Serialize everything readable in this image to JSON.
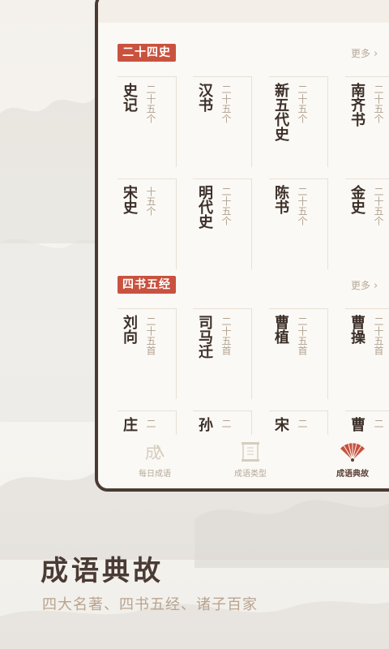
{
  "sections": [
    {
      "tag": "二十四史",
      "more_label": "更多",
      "items": [
        {
          "name": "史记",
          "count": "二十五个"
        },
        {
          "name": "汉书",
          "count": "二十五个"
        },
        {
          "name": "新五代史",
          "count": "二十五个"
        },
        {
          "name": "南齐书",
          "count": "二十五个"
        },
        {
          "name": "宋史",
          "count": "十五个"
        },
        {
          "name": "明代史",
          "count": "二十五个"
        },
        {
          "name": "陈书",
          "count": "二十五个"
        },
        {
          "name": "金史",
          "count": "二十五个"
        }
      ]
    },
    {
      "tag": "四书五经",
      "more_label": "更多",
      "items": [
        {
          "name": "刘向",
          "count": "二十五首"
        },
        {
          "name": "司马迁",
          "count": "二十五首"
        },
        {
          "name": "曹植",
          "count": "二十五首"
        },
        {
          "name": "曹操",
          "count": "二十五首"
        },
        {
          "name": "庄",
          "count": "二"
        },
        {
          "name": "孙",
          "count": "二"
        },
        {
          "name": "宋",
          "count": "二"
        },
        {
          "name": "曹",
          "count": "二"
        }
      ]
    }
  ],
  "tabs": [
    {
      "label": "每日成语",
      "icon": "daily-idiom-icon",
      "active": false
    },
    {
      "label": "成语类型",
      "icon": "scroll-icon",
      "active": false
    },
    {
      "label": "成语典故",
      "icon": "fan-icon",
      "active": true
    }
  ],
  "headline": "成语典故",
  "subline": "四大名著、四书五经、诸子百家",
  "colors": {
    "accent": "#c9523f",
    "frame": "#4a3a33",
    "text_dark": "#3c2f29",
    "text_muted": "#b3a392"
  }
}
